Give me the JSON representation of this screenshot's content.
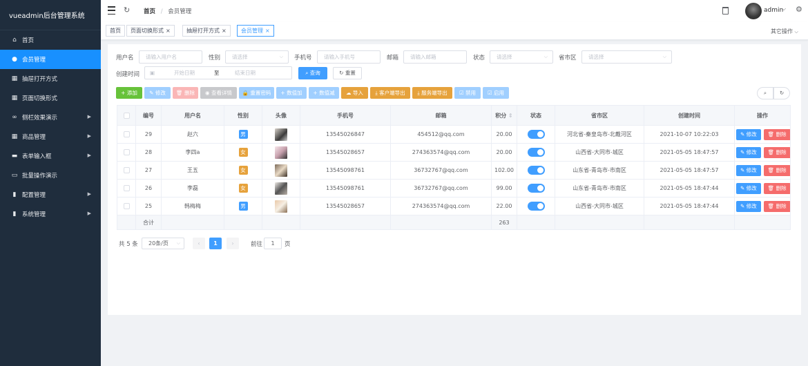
{
  "app": {
    "title": "vueadmin后台管理系统"
  },
  "sidebar": {
    "items": [
      {
        "label": "首页",
        "icon": "home-icon",
        "glyph": "⌂",
        "active": false,
        "has_children": false
      },
      {
        "label": "会员管理",
        "icon": "user-icon",
        "glyph": "●",
        "active": true,
        "has_children": false
      },
      {
        "label": "抽屉打开方式",
        "icon": "grid-icon",
        "glyph": "▦",
        "active": false,
        "has_children": false
      },
      {
        "label": "页面切换形式",
        "icon": "grid-icon",
        "glyph": "▦",
        "active": false,
        "has_children": false
      },
      {
        "label": "侧栏效果演示",
        "icon": "link-icon",
        "glyph": "∞",
        "active": false,
        "has_children": true
      },
      {
        "label": "商品管理",
        "icon": "grid-icon",
        "glyph": "▦",
        "active": false,
        "has_children": true
      },
      {
        "label": "表单输入框",
        "icon": "form-icon",
        "glyph": "▬",
        "active": false,
        "has_children": true
      },
      {
        "label": "批量操作演示",
        "icon": "window-icon",
        "glyph": "▭",
        "active": false,
        "has_children": false
      },
      {
        "label": "配置管理",
        "icon": "bar-chart-icon",
        "glyph": "▮",
        "active": false,
        "has_children": true
      },
      {
        "label": "系统管理",
        "icon": "bar-chart-icon",
        "glyph": "▮",
        "active": false,
        "has_children": true
      }
    ]
  },
  "navbar": {
    "breadcrumb_home": "首页",
    "breadcrumb_sep": "/",
    "breadcrumb_current": "会员管理",
    "username": "admin",
    "caret": "⌵"
  },
  "tags": {
    "items": [
      {
        "label": "首页",
        "closable": false,
        "active": false
      },
      {
        "label": "页面切换形式",
        "closable": true,
        "active": false
      },
      {
        "label": "抽屉打开方式",
        "closable": true,
        "active": false
      },
      {
        "label": "会员管理",
        "closable": true,
        "active": true
      }
    ],
    "close_glyph": "×",
    "other_ops": "其它操作",
    "other_caret": "⌵"
  },
  "filters": {
    "username": {
      "label": "用户名",
      "placeholder": "请输入用户名"
    },
    "gender": {
      "label": "性别",
      "placeholder": "请选择"
    },
    "phone": {
      "label": "手机号",
      "placeholder": "请输入手机号"
    },
    "email": {
      "label": "邮箱",
      "placeholder": "请输入邮箱"
    },
    "status": {
      "label": "状态",
      "placeholder": "请选择"
    },
    "region": {
      "label": "省市区",
      "placeholder": "请选择"
    },
    "created": {
      "label": "创建时间",
      "start": "开始日期",
      "sep": "至",
      "end": "结束日期"
    },
    "search_btn": "查询",
    "reset_btn": "重置",
    "dropdown_glyph": "⌵"
  },
  "toolbar": {
    "buttons": [
      {
        "label": "+ 添加",
        "color": "#67c23a"
      },
      {
        "label": "✎ 修改",
        "color": "#a0cfff"
      },
      {
        "label": "🗑 删除",
        "color": "#fab6b6"
      },
      {
        "label": "◉ 查看详情",
        "color": "#c8c9cc"
      },
      {
        "label": "🔒 重置密码",
        "color": "#a0cfff"
      },
      {
        "label": "+ 数值加",
        "color": "#a0cfff"
      },
      {
        "label": "+ 数值减",
        "color": "#a0cfff"
      },
      {
        "label": "☁ 导入",
        "color": "#e6a23c"
      },
      {
        "label": "⤓ 客户端导出",
        "color": "#e6a23c"
      },
      {
        "label": "⤓ 服务端导出",
        "color": "#e6a23c"
      },
      {
        "label": "☑ 禁用",
        "color": "#a0cfff"
      },
      {
        "label": "☑ 启用",
        "color": "#a0cfff"
      }
    ]
  },
  "table": {
    "columns": [
      "",
      "编号",
      "用户名",
      "性别",
      "头像",
      "手机号",
      "邮箱",
      "积分",
      "状态",
      "省市区",
      "创建时间",
      "操作"
    ],
    "sort_glyph": "⇕",
    "edit_label": "✎ 修改",
    "delete_label": "🗑 删除",
    "rows": [
      {
        "id": "29",
        "username": "赵六",
        "gender": "男",
        "phone": "13545026847",
        "email": "454512@qq.com",
        "points": "20.00",
        "region": "河北省-秦皇岛市-北戴河区",
        "created": "2021-10-07 10:22:03"
      },
      {
        "id": "28",
        "username": "李四a",
        "gender": "女",
        "phone": "13545028657",
        "email": "274363574@qq.com",
        "points": "20.00",
        "region": "山西省-大同市-城区",
        "created": "2021-05-05 18:47:57"
      },
      {
        "id": "27",
        "username": "王五",
        "gender": "女",
        "phone": "13545098761",
        "email": "36732767@qq.com",
        "points": "102.00",
        "region": "山东省-青岛市-市南区",
        "created": "2021-05-05 18:47:57"
      },
      {
        "id": "26",
        "username": "李磊",
        "gender": "女",
        "phone": "13545098761",
        "email": "36732767@qq.com",
        "points": "99.00",
        "region": "山东省-青岛市-市南区",
        "created": "2021-05-05 18:47:44"
      },
      {
        "id": "25",
        "username": "韩梅梅",
        "gender": "男",
        "phone": "13545028657",
        "email": "274363574@qq.com",
        "points": "22.00",
        "region": "山西省-大同市-城区",
        "created": "2021-05-05 18:47:44"
      }
    ],
    "summary_label": "合计",
    "summary_points": "263"
  },
  "pagination": {
    "total": "共 5 条",
    "page_size": "20条/页",
    "prev": "‹",
    "current": "1",
    "next": "›",
    "goto_label": "前往",
    "goto_value": "1",
    "goto_suffix": "页"
  },
  "colors": {
    "primary": "#409eff",
    "sidebar_bg": "#1f2d3d",
    "male": "#409eff",
    "female": "#e6a23c",
    "danger": "#f56c6c"
  }
}
